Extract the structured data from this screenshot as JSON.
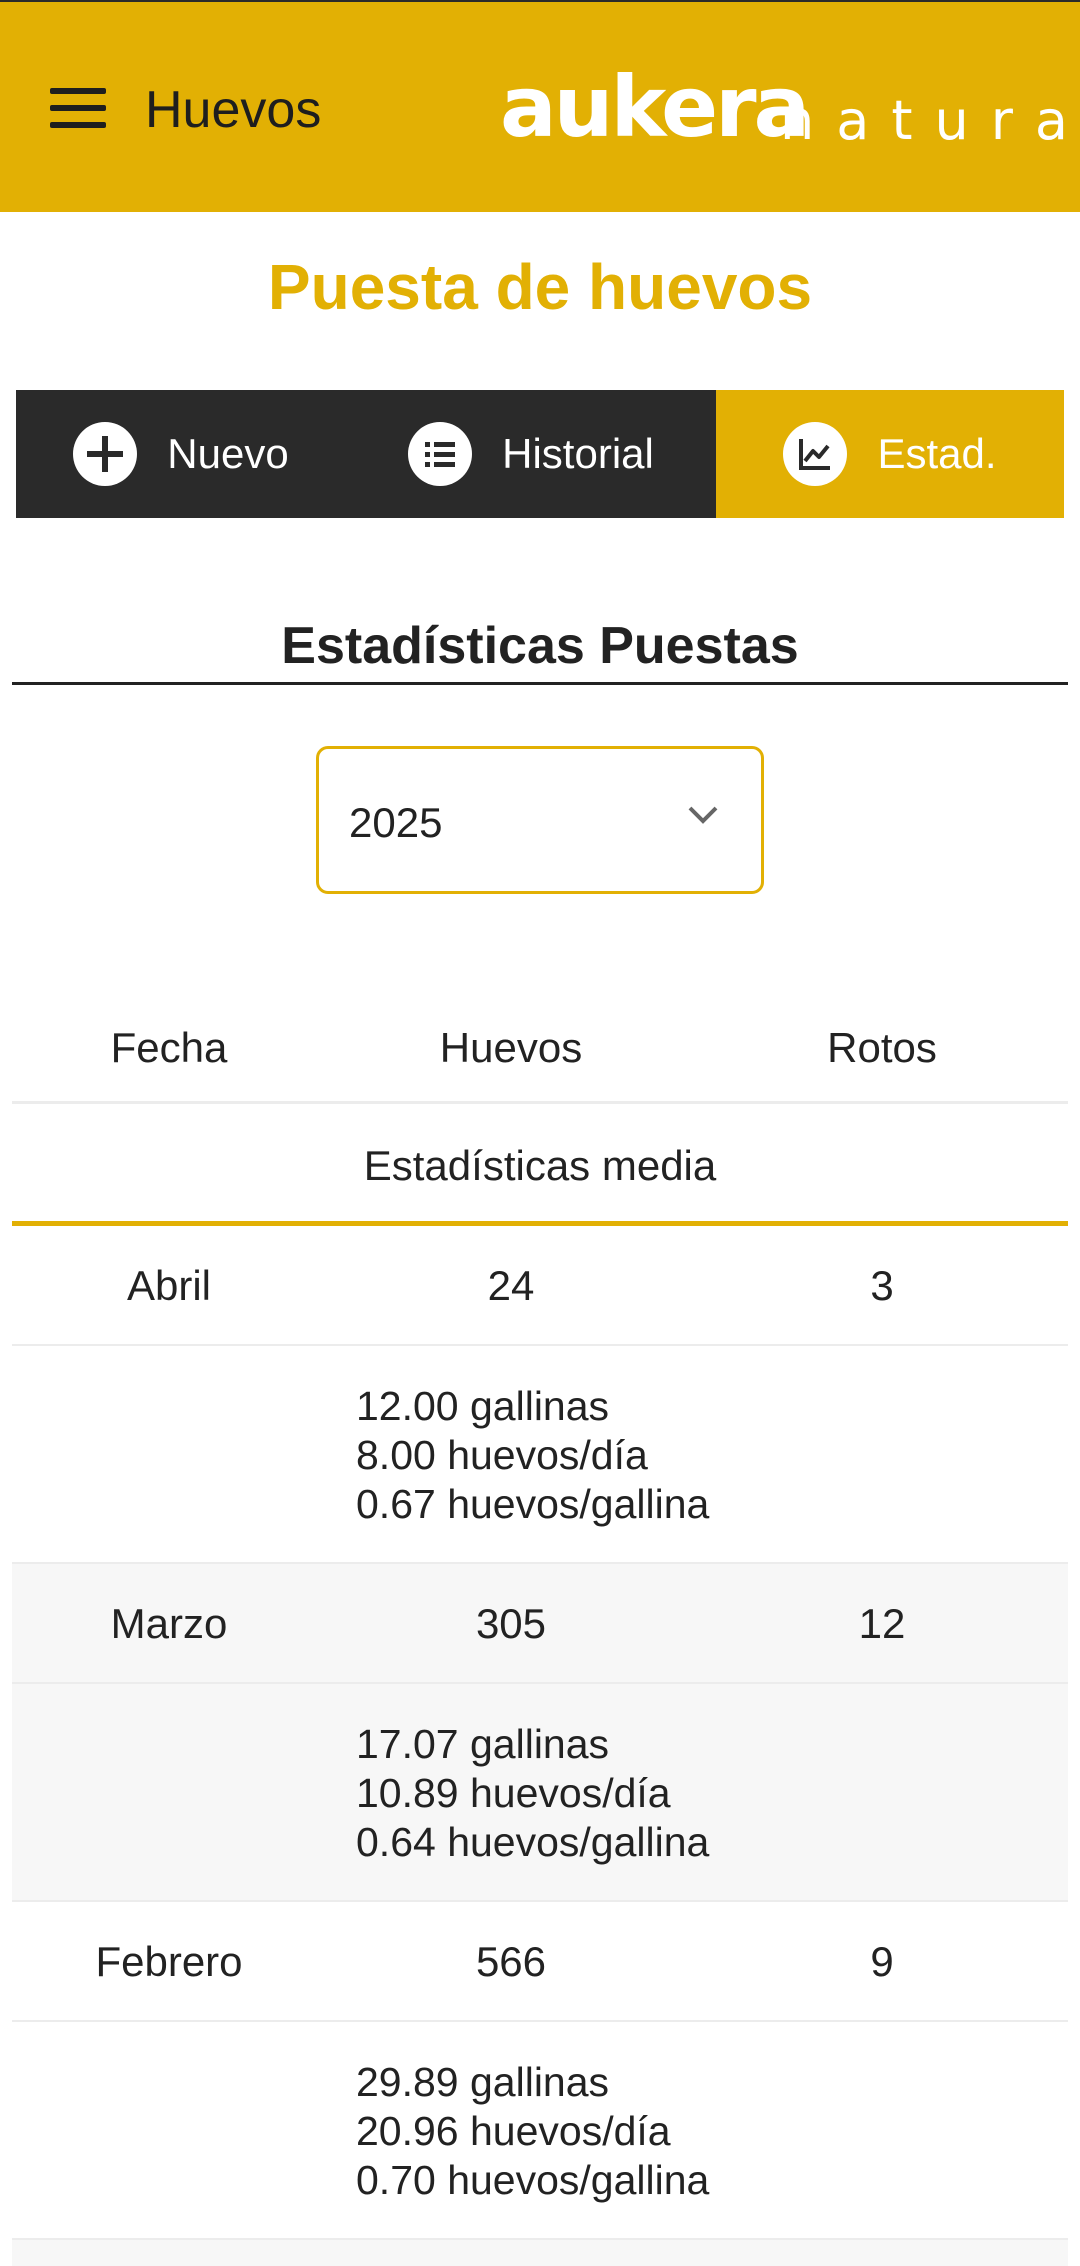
{
  "header": {
    "title": "Huevos",
    "logo_main": "aukera",
    "logo_sub": "natura"
  },
  "page_title": "Puesta de huevos",
  "tabs": [
    {
      "label": "Nuevo",
      "icon": "plus-circle-icon",
      "active": false
    },
    {
      "label": "Historial",
      "icon": "list-icon",
      "active": false
    },
    {
      "label": "Estad.",
      "icon": "chart-line-icon",
      "active": true
    }
  ],
  "section_title": "Estadísticas Puestas",
  "year_select": {
    "value": "2025",
    "icon": "chevron-down-icon"
  },
  "table": {
    "headers": {
      "fecha": "Fecha",
      "huevos": "Huevos",
      "rotos": "Rotos"
    },
    "stats_label": "Estadísticas media",
    "months": [
      {
        "fecha": "Abril",
        "huevos": "24",
        "rotos": "3",
        "gallinas": "12.00 gallinas",
        "huevos_dia": "8.00 huevos/día",
        "huevos_gallina": "0.67 huevos/gallina"
      },
      {
        "fecha": "Marzo",
        "huevos": "305",
        "rotos": "12",
        "gallinas": "17.07 gallinas",
        "huevos_dia": "10.89 huevos/día",
        "huevos_gallina": "0.64 huevos/gallina"
      },
      {
        "fecha": "Febrero",
        "huevos": "566",
        "rotos": "9",
        "gallinas": "29.89 gallinas",
        "huevos_dia": "20.96 huevos/día",
        "huevos_gallina": "0.70 huevos/gallina"
      }
    ]
  },
  "colors": {
    "accent": "#e2b004",
    "dark": "#2a2a2a",
    "row_shade": "#f7f7f7"
  }
}
